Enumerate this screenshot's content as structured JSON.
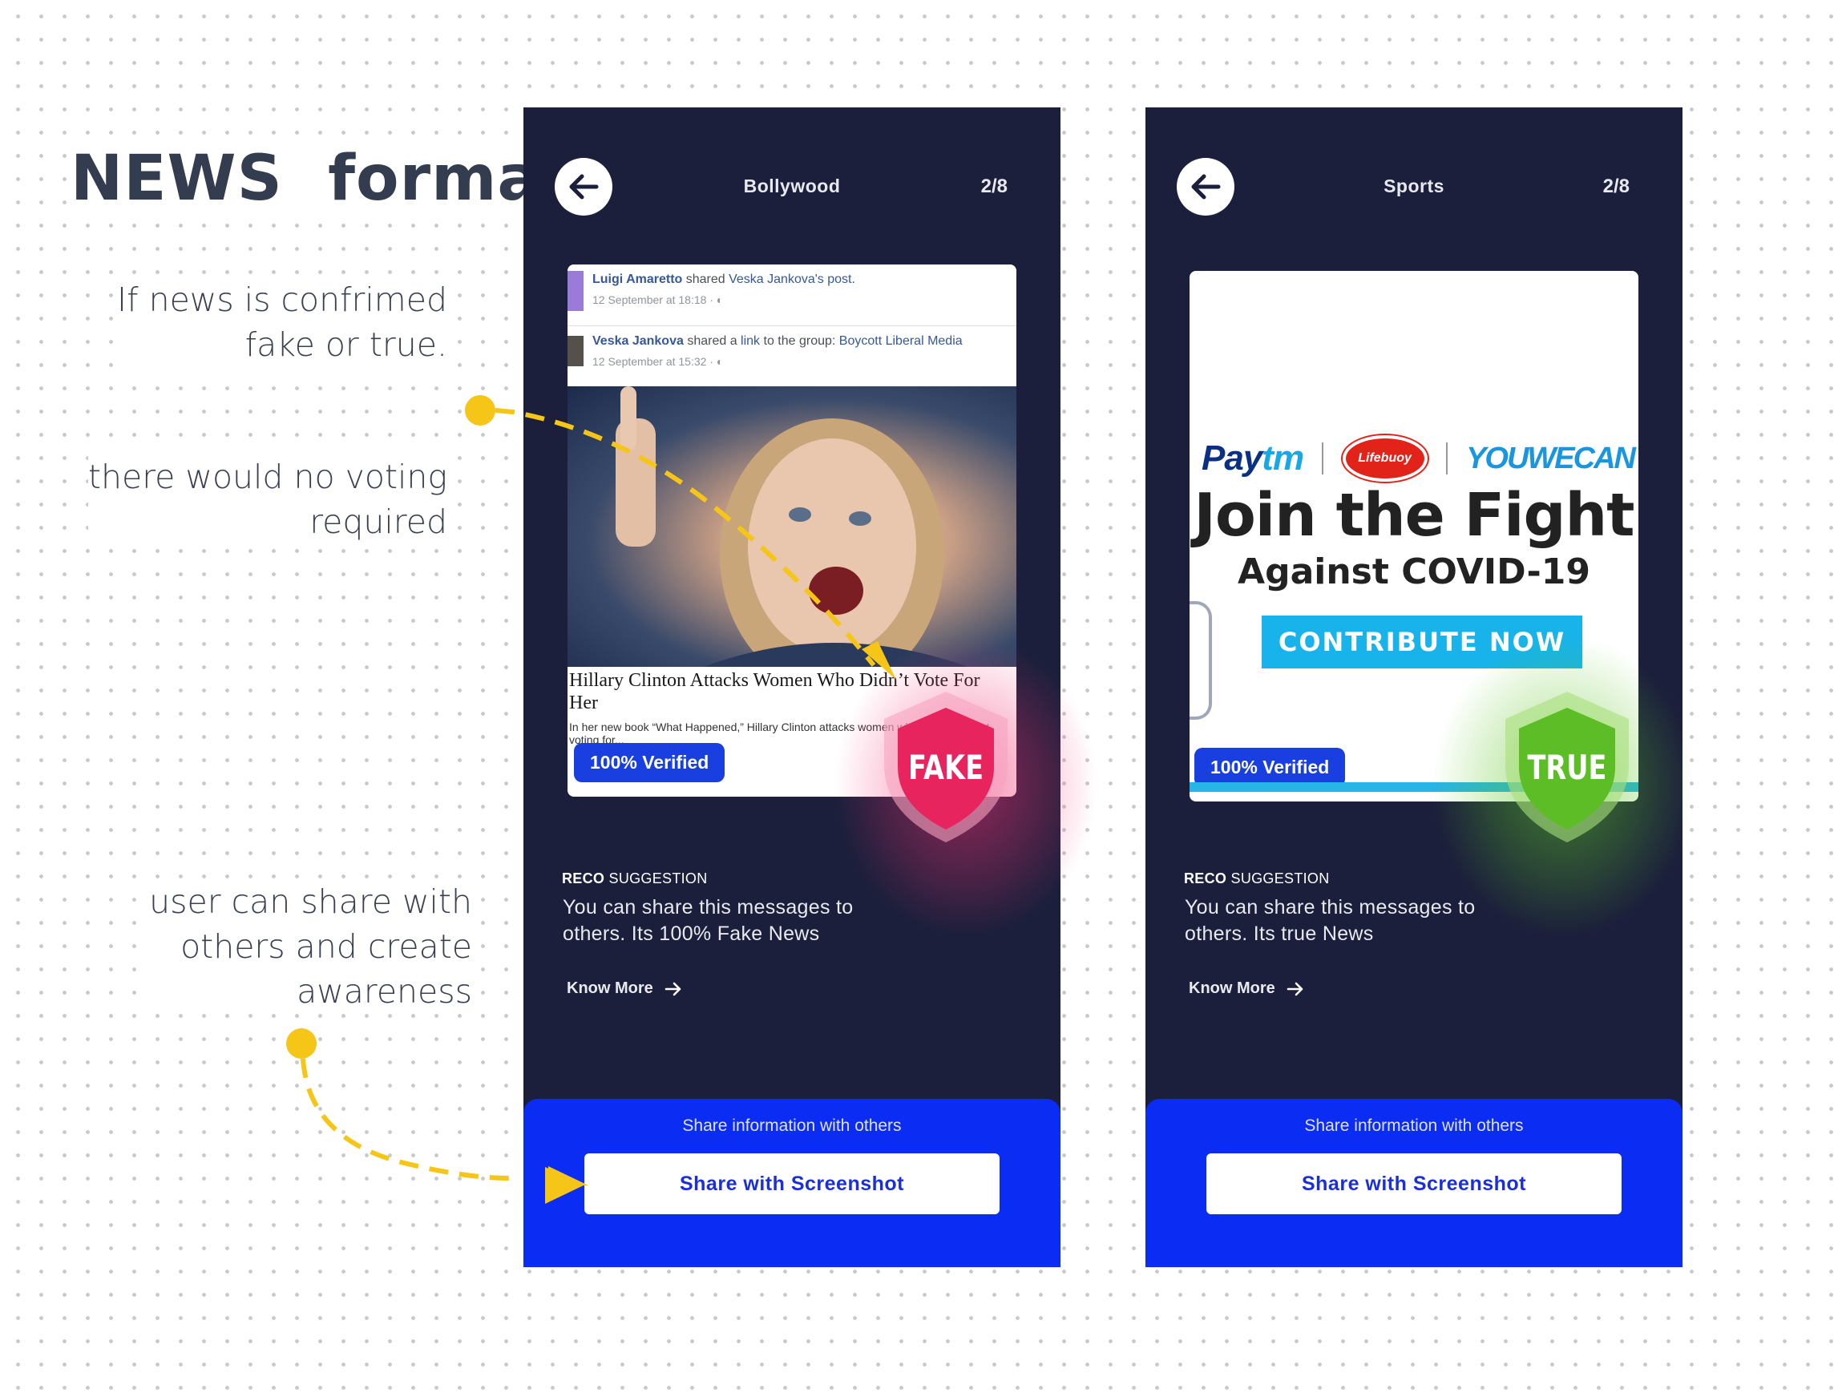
{
  "title": "NEWS  format",
  "notes": {
    "note1": "If news is confrimed\nfake or true.",
    "note2": "there would no voting\nrequired",
    "note3": "user can share with\nothers and create\nawareness"
  },
  "colors": {
    "phone_bg": "#1b1f3b",
    "share_panel": "#0b2cf2",
    "verified_badge": "#1a3fe0",
    "fake": "#e8245f",
    "true": "#5cbd26",
    "annotation": "#f5c518"
  },
  "phones": [
    {
      "category": "Bollywood",
      "counter": "2/8",
      "post": {
        "row1": {
          "name": "Luigi Amaretto",
          "action": " shared ",
          "target": "Veska Jankova's post.",
          "time": "12 September at 18:18 · ◐"
        },
        "row2": {
          "name": "Veska Jankova",
          "action": " shared a ",
          "link": "link",
          "action2": " to the group: ",
          "group": "Boycott Liberal Media",
          "time": "12 September at 15:32 · ◐"
        },
        "headline": "Hillary Clinton Attacks Women Who Didn’t Vote For Her",
        "snippet": "In her new book “What Happened,” Hillary Clinton attacks women who reportedly not voting for..."
      },
      "verified": "100% Verified",
      "verdict": "FAKE",
      "reco_label_bold": "RECO",
      "reco_label": " SUGGESTION",
      "reco_text": "You can share this messages to others. Its 100% Fake News",
      "know_more": "Know More",
      "share_caption": "Share information with others",
      "share_button": "Share with Screenshot"
    },
    {
      "category": "Sports",
      "counter": "2/8",
      "ad": {
        "logo1_a": "Pay",
        "logo1_b": "tm",
        "logo2": "Lifebuoy",
        "logo3": "YOUWECAN",
        "headline": "Join the Fight",
        "subhead": "Against COVID-19",
        "cta": "CONTRIBUTE NOW"
      },
      "verified": "100%  Verified",
      "verdict": "TRUE",
      "reco_label_bold": "RECO",
      "reco_label": " SUGGESTION",
      "reco_text": "You can share this messages to others. Its true News",
      "know_more": "Know More",
      "share_caption": "Share information with others",
      "share_button": "Share with Screenshot"
    }
  ]
}
